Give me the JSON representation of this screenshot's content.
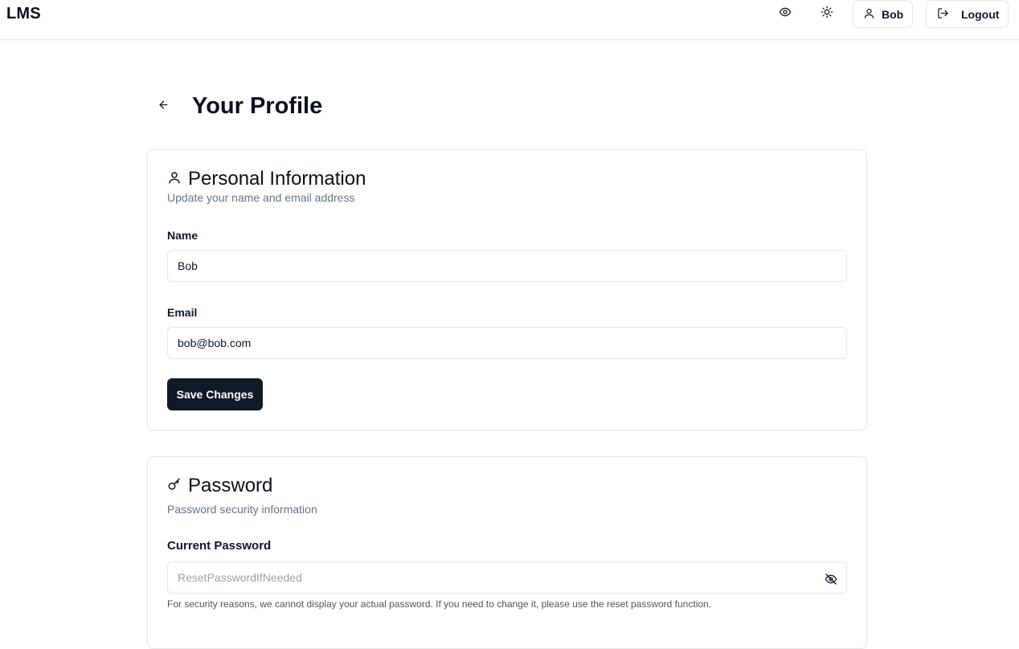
{
  "header": {
    "brand": "LMS",
    "user_label": "Bob",
    "logout_label": "Logout"
  },
  "page": {
    "title": "Your Profile"
  },
  "personal": {
    "title": "Personal Information",
    "subtitle": "Update your name and email address",
    "name_label": "Name",
    "name_value": "Bob",
    "email_label": "Email",
    "email_value": "bob@bob.com",
    "save_label": "Save Changes"
  },
  "password": {
    "title": "Password",
    "subtitle": "Password security information",
    "current_label": "Current Password",
    "current_placeholder": "ResetPasswordIfNeeded",
    "help": "For security reasons, we cannot display your actual password. If you need to change it, please use the reset password function."
  },
  "icons": {
    "preview": "eye-icon",
    "theme": "sun-icon",
    "user": "user-icon",
    "logout": "logout-icon",
    "back": "arrow-left-icon",
    "personal": "user-icon",
    "password": "key-icon",
    "toggle_visibility": "eye-off-icon"
  },
  "colors": {
    "primary_button": "#111827",
    "muted_text": "#64748b",
    "border": "#e5e7eb"
  }
}
